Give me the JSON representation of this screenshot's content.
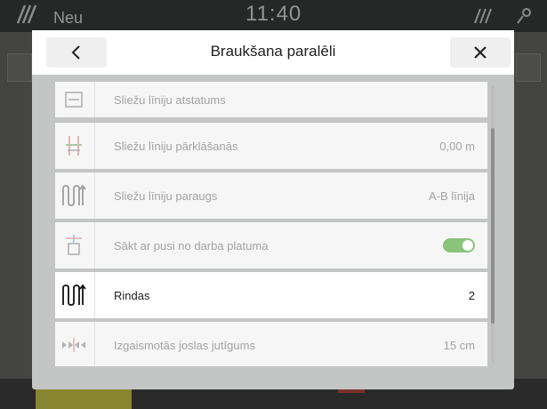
{
  "background": {
    "status_left": "Neu",
    "time": "11:40"
  },
  "dialog": {
    "title": "Braukšana paralēli",
    "back_icon": "chevron-left-icon",
    "close_icon": "close-icon"
  },
  "rows": [
    {
      "label": "Sliežu līniju atstatums",
      "value": "",
      "icon": "track-spacing-icon"
    },
    {
      "label": "Sliežu līniju pārklāšanās",
      "value": "0,00 m",
      "icon": "track-overlap-icon"
    },
    {
      "label": "Sliežu līniju paraugs",
      "value": "A-B līnija",
      "icon": "track-pattern-icon"
    },
    {
      "label": "Sākt ar pusi no darba platuma",
      "value": "",
      "icon": "half-width-start-icon",
      "toggle": true
    },
    {
      "label": "Rindas",
      "value": "2",
      "icon": "rows-icon"
    },
    {
      "label": "Izgaismotās joslas jutīgums",
      "value": "15 cm",
      "icon": "lightbar-sensitivity-icon"
    }
  ],
  "colors": {
    "toggle_on": "#8ac37a",
    "dialog_bg": "#c4c5c5"
  }
}
